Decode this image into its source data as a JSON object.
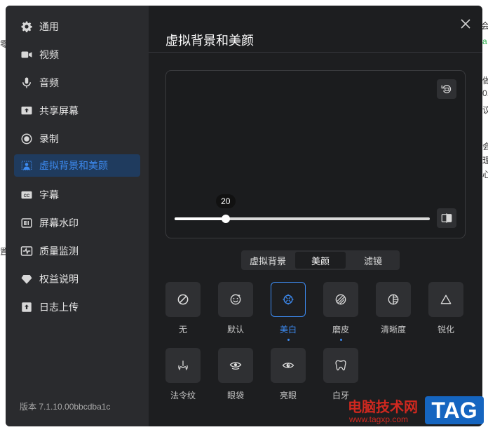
{
  "background": {
    "fragments": [
      "会议",
      "a",
      "零",
      "做",
      "0.",
      "议",
      "会",
      "理",
      "心",
      "置"
    ]
  },
  "sidebar": {
    "items": [
      {
        "label": "通用",
        "icon": "gear-icon"
      },
      {
        "label": "视频",
        "icon": "video-camera-icon"
      },
      {
        "label": "音频",
        "icon": "microphone-icon"
      },
      {
        "label": "共享屏幕",
        "icon": "share-screen-icon"
      },
      {
        "label": "录制",
        "icon": "record-icon"
      },
      {
        "label": "虚拟背景和美颜",
        "icon": "virtual-background-icon"
      },
      {
        "label": "字幕",
        "icon": "caption-icon"
      },
      {
        "label": "屏幕水印",
        "icon": "watermark-icon"
      },
      {
        "label": "质量监测",
        "icon": "pulse-icon"
      },
      {
        "label": "权益说明",
        "icon": "diamond-icon"
      },
      {
        "label": "日志上传",
        "icon": "upload-icon"
      }
    ],
    "active_index": 5,
    "version": "版本 7.1.10.00bbcdba1c"
  },
  "main": {
    "title": "虚拟背景和美颜",
    "slider": {
      "value": "20",
      "fraction": 0.2
    }
  },
  "tabs": {
    "items": [
      "虚拟背景",
      "美颜",
      "滤镜"
    ],
    "active_index": 1
  },
  "effects": [
    {
      "label": "无",
      "icon": "none-icon"
    },
    {
      "label": "默认",
      "icon": "default-face-icon"
    },
    {
      "label": "美白",
      "icon": "whitening-icon",
      "selected": true,
      "dot": true
    },
    {
      "label": "磨皮",
      "icon": "smoothing-icon",
      "dot": true
    },
    {
      "label": "清晰度",
      "icon": "clarity-icon"
    },
    {
      "label": "锐化",
      "icon": "sharpen-icon"
    },
    {
      "label": "法令纹",
      "icon": "nasolabial-icon"
    },
    {
      "label": "眼袋",
      "icon": "eye-bag-icon"
    },
    {
      "label": "亮眼",
      "icon": "bright-eye-icon"
    },
    {
      "label": "白牙",
      "icon": "tooth-icon"
    }
  ],
  "watermark": {
    "site": "电脑技术网",
    "url": "www.tagxp.com",
    "tag": "TAG"
  },
  "colors": {
    "accent": "#3d8bf2",
    "dialog_bg": "#1d1e20",
    "sidebar_bg": "#2a2b2e",
    "active_bg": "#1f3b5e"
  }
}
